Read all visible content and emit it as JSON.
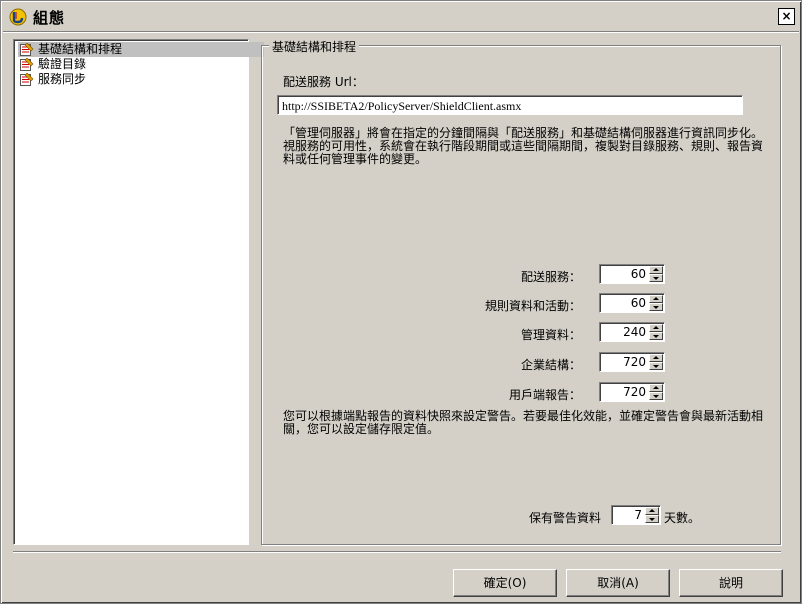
{
  "window": {
    "title": "組態",
    "close_label": "×"
  },
  "tree": {
    "items": [
      {
        "label": "基礎結構和排程",
        "selected": true
      },
      {
        "label": "驗證目錄",
        "selected": false
      },
      {
        "label": "服務同步",
        "selected": false
      }
    ]
  },
  "group": {
    "legend": "基礎結構和排程",
    "url_label": "配送服務 Url：",
    "url_value": "http://SSIBETA2/PolicyServer/ShieldClient.asmx",
    "sync_text_1": "「管理伺服器」將會在指定的分鐘間隔與「配送服務」和基礎結構伺服器進行資訊同步化。",
    "sync_text_2": "視服務的可用性，系統會在執行階段期間或這些間隔期間，複製對目錄服務、規則、報告資",
    "sync_text_3": "料或任何管理事件的變更。",
    "intervals": [
      {
        "label": "配送服務：",
        "value": "60"
      },
      {
        "label": "規則資料和活動：",
        "value": "60"
      },
      {
        "label": "管理資料：",
        "value": "240"
      },
      {
        "label": "企業結構：",
        "value": "720"
      },
      {
        "label": "用戶端報告：",
        "value": "720"
      }
    ],
    "alert_text_1": "您可以根據端點報告的資料快照來設定警告。若要最佳化效能，並確定警告會與最新活動相",
    "alert_text_2": "關，您可以設定儲存限定值。",
    "retain_label": "保有警告資料",
    "retain_value": "7",
    "retain_unit": "天數。"
  },
  "buttons": {
    "ok": "確定(O)",
    "cancel": "取消(A)",
    "help": "說明"
  }
}
